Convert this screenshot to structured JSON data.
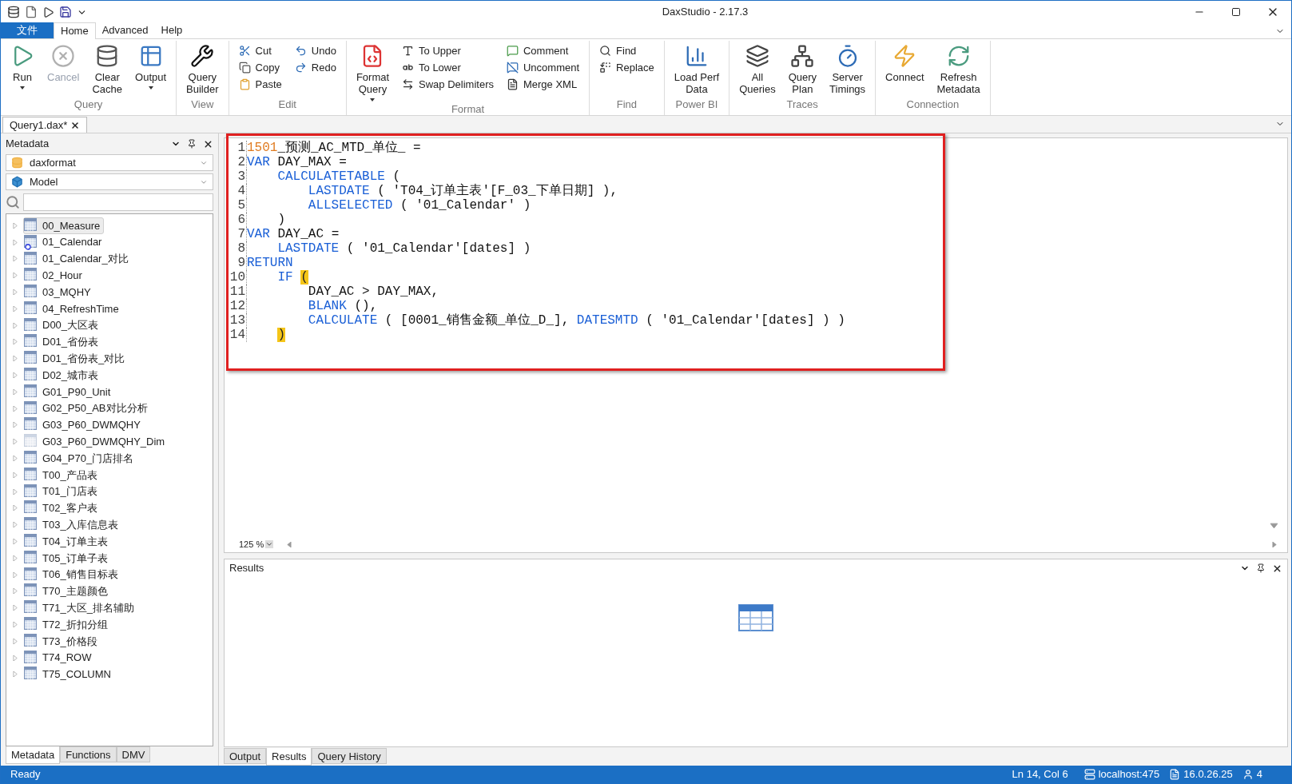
{
  "window": {
    "title": "DaxStudio - 2.17.3"
  },
  "menu_tabs": [
    {
      "label": "文件",
      "kind": "file",
      "selected": false
    },
    {
      "label": "Home",
      "kind": "tab",
      "selected": true
    },
    {
      "label": "Advanced",
      "kind": "tab",
      "selected": false
    },
    {
      "label": "Help",
      "kind": "tab",
      "selected": false
    }
  ],
  "ribbon_groups": [
    {
      "label": "Query",
      "buttons": [
        {
          "label": "Run",
          "kind": "large",
          "dropdown": true,
          "disabled": false
        },
        {
          "label": "Cancel",
          "kind": "large",
          "dropdown": false,
          "disabled": true
        },
        {
          "label": "Clear\nCache",
          "kind": "large",
          "dropdown": false,
          "disabled": false
        },
        {
          "label": "Output",
          "kind": "large",
          "dropdown": true,
          "disabled": false
        }
      ]
    },
    {
      "label": "View",
      "buttons": [
        {
          "label": "Query\nBuilder",
          "kind": "large",
          "dropdown": false,
          "disabled": false
        }
      ]
    },
    {
      "label": "Edit",
      "buttons": [
        {
          "label": "Cut",
          "kind": "small",
          "disabled": false
        },
        {
          "label": "Copy",
          "kind": "small",
          "disabled": false
        },
        {
          "label": "Paste",
          "kind": "small",
          "disabled": false
        },
        {
          "label": "Undo",
          "kind": "small",
          "disabled": false
        },
        {
          "label": "Redo",
          "kind": "small",
          "disabled": false
        }
      ]
    },
    {
      "label": "Format",
      "buttons": [
        {
          "label": "Format\nQuery",
          "kind": "large",
          "dropdown": true,
          "disabled": false
        },
        {
          "label": "To Upper",
          "kind": "small",
          "disabled": false
        },
        {
          "label": "To Lower",
          "kind": "small",
          "disabled": false
        },
        {
          "label": "Swap Delimiters",
          "kind": "small",
          "disabled": false
        },
        {
          "label": "Comment",
          "kind": "small",
          "disabled": false
        },
        {
          "label": "Uncomment",
          "kind": "small",
          "disabled": false
        },
        {
          "label": "Merge XML",
          "kind": "small",
          "disabled": false
        }
      ]
    },
    {
      "label": "Find",
      "buttons": [
        {
          "label": "Find",
          "kind": "small",
          "disabled": false
        },
        {
          "label": "Replace",
          "kind": "small",
          "disabled": false
        }
      ]
    },
    {
      "label": "Power BI",
      "buttons": [
        {
          "label": "Load Perf\nData",
          "kind": "large",
          "dropdown": false,
          "disabled": false
        }
      ]
    },
    {
      "label": "Traces",
      "buttons": [
        {
          "label": "All\nQueries",
          "kind": "large",
          "dropdown": false,
          "disabled": false
        },
        {
          "label": "Query\nPlan",
          "kind": "large",
          "dropdown": false,
          "disabled": false
        },
        {
          "label": "Server\nTimings",
          "kind": "large",
          "dropdown": false,
          "disabled": false
        }
      ]
    },
    {
      "label": "Connection",
      "buttons": [
        {
          "label": "Connect",
          "kind": "large",
          "dropdown": false,
          "disabled": false
        },
        {
          "label": "Refresh\nMetadata",
          "kind": "large",
          "dropdown": false,
          "disabled": false
        }
      ]
    }
  ],
  "document_tab": {
    "label": "Query1.dax*"
  },
  "metadata_panel": {
    "title": "Metadata",
    "database": "daxformat",
    "model": "Model",
    "tree": [
      {
        "label": "00_Measure",
        "kind": "table",
        "selected": true,
        "hidden": false
      },
      {
        "label": "01_Calendar",
        "kind": "date_table",
        "selected": false,
        "hidden": false
      },
      {
        "label": "01_Calendar_对比",
        "kind": "table",
        "selected": false,
        "hidden": false
      },
      {
        "label": "02_Hour",
        "kind": "table",
        "selected": false,
        "hidden": false
      },
      {
        "label": "03_MQHY",
        "kind": "table",
        "selected": false,
        "hidden": false
      },
      {
        "label": "04_RefreshTime",
        "kind": "table",
        "selected": false,
        "hidden": false
      },
      {
        "label": "D00_大区表",
        "kind": "table",
        "selected": false,
        "hidden": false
      },
      {
        "label": "D01_省份表",
        "kind": "table",
        "selected": false,
        "hidden": false
      },
      {
        "label": "D01_省份表_对比",
        "kind": "table",
        "selected": false,
        "hidden": false
      },
      {
        "label": "D02_城市表",
        "kind": "table",
        "selected": false,
        "hidden": false
      },
      {
        "label": "G01_P90_Unit",
        "kind": "table",
        "selected": false,
        "hidden": false
      },
      {
        "label": "G02_P50_AB对比分析",
        "kind": "table",
        "selected": false,
        "hidden": false
      },
      {
        "label": "G03_P60_DWMQHY",
        "kind": "table",
        "selected": false,
        "hidden": false
      },
      {
        "label": "G03_P60_DWMQHY_Dim",
        "kind": "table",
        "selected": false,
        "hidden": true
      },
      {
        "label": "G04_P70_门店排名",
        "kind": "table",
        "selected": false,
        "hidden": false
      },
      {
        "label": "T00_产品表",
        "kind": "table",
        "selected": false,
        "hidden": false
      },
      {
        "label": "T01_门店表",
        "kind": "table",
        "selected": false,
        "hidden": false
      },
      {
        "label": "T02_客户表",
        "kind": "table",
        "selected": false,
        "hidden": false
      },
      {
        "label": "T03_入库信息表",
        "kind": "table",
        "selected": false,
        "hidden": false
      },
      {
        "label": "T04_订单主表",
        "kind": "table",
        "selected": false,
        "hidden": false
      },
      {
        "label": "T05_订单子表",
        "kind": "table",
        "selected": false,
        "hidden": false
      },
      {
        "label": "T06_销售目标表",
        "kind": "table",
        "selected": false,
        "hidden": false
      },
      {
        "label": "T70_主题颜色",
        "kind": "table",
        "selected": false,
        "hidden": false
      },
      {
        "label": "T71_大区_排名辅助",
        "kind": "table",
        "selected": false,
        "hidden": false
      },
      {
        "label": "T72_折扣分组",
        "kind": "table",
        "selected": false,
        "hidden": false
      },
      {
        "label": "T73_价格段",
        "kind": "table",
        "selected": false,
        "hidden": false
      },
      {
        "label": "T74_ROW",
        "kind": "table",
        "selected": false,
        "hidden": false
      },
      {
        "label": "T75_COLUMN",
        "kind": "table",
        "selected": false,
        "hidden": false
      }
    ],
    "tabs": [
      {
        "label": "Metadata",
        "selected": true
      },
      {
        "label": "Functions",
        "selected": false
      },
      {
        "label": "DMV",
        "selected": false
      }
    ]
  },
  "editor": {
    "lines": [
      {
        "number": "1",
        "tokens": [
          {
            "text": "1501",
            "kind": "number"
          },
          {
            "text": "_预测_AC_MTD_单位_ =",
            "kind": "plain"
          }
        ]
      },
      {
        "number": "2",
        "tokens": [
          {
            "text": "VAR",
            "kind": "keyword"
          },
          {
            "text": " DAY_MAX =",
            "kind": "plain"
          }
        ]
      },
      {
        "number": "3",
        "tokens": [
          {
            "text": "    CALCULATETABLE",
            "kind": "keyword"
          },
          {
            "text": " (",
            "kind": "plain"
          }
        ]
      },
      {
        "number": "4",
        "tokens": [
          {
            "text": "        LASTDATE",
            "kind": "keyword"
          },
          {
            "text": " ( 'T04_订单主表'[F_03_下单日期] ),",
            "kind": "plain"
          }
        ]
      },
      {
        "number": "5",
        "tokens": [
          {
            "text": "        ALLSELECTED",
            "kind": "keyword"
          },
          {
            "text": " ( '01_Calendar' )",
            "kind": "plain"
          }
        ]
      },
      {
        "number": "6",
        "tokens": [
          {
            "text": "    )",
            "kind": "plain"
          }
        ]
      },
      {
        "number": "7",
        "tokens": [
          {
            "text": "VAR",
            "kind": "keyword"
          },
          {
            "text": " DAY_AC =",
            "kind": "plain"
          }
        ]
      },
      {
        "number": "8",
        "tokens": [
          {
            "text": "    LASTDATE",
            "kind": "keyword"
          },
          {
            "text": " ( '01_Calendar'[dates] )",
            "kind": "plain"
          }
        ]
      },
      {
        "number": "9",
        "tokens": [
          {
            "text": "RETURN",
            "kind": "keyword"
          }
        ]
      },
      {
        "number": "10",
        "tokens": [
          {
            "text": "    IF",
            "kind": "keyword"
          },
          {
            "text": " (",
            "kind": "match"
          }
        ]
      },
      {
        "number": "11",
        "tokens": [
          {
            "text": "        DAY_AC > DAY_MAX,",
            "kind": "plain"
          }
        ]
      },
      {
        "number": "12",
        "tokens": [
          {
            "text": "        BLANK",
            "kind": "keyword"
          },
          {
            "text": " (),",
            "kind": "plain"
          }
        ]
      },
      {
        "number": "13",
        "tokens": [
          {
            "text": "        CALCULATE",
            "kind": "keyword"
          },
          {
            "text": " ( [0001_销售金额_单位_D_], ",
            "kind": "plain"
          },
          {
            "text": "DATESMTD",
            "kind": "keyword"
          },
          {
            "text": " ( '01_Calendar'[dates] ) )",
            "kind": "plain"
          }
        ]
      },
      {
        "number": "14",
        "tokens": [
          {
            "text": "    )",
            "kind": "match"
          }
        ]
      }
    ],
    "zoom": "125 %"
  },
  "results_panel": {
    "title": "Results"
  },
  "bottom_tabs": [
    {
      "label": "Output",
      "selected": false
    },
    {
      "label": "Results",
      "selected": true
    },
    {
      "label": "Query History",
      "selected": false
    }
  ],
  "status_bar": {
    "message": "Ready",
    "position": "Ln 14, Col 6",
    "server": "localhost:475",
    "version": "16.0.26.25",
    "users": "4"
  }
}
